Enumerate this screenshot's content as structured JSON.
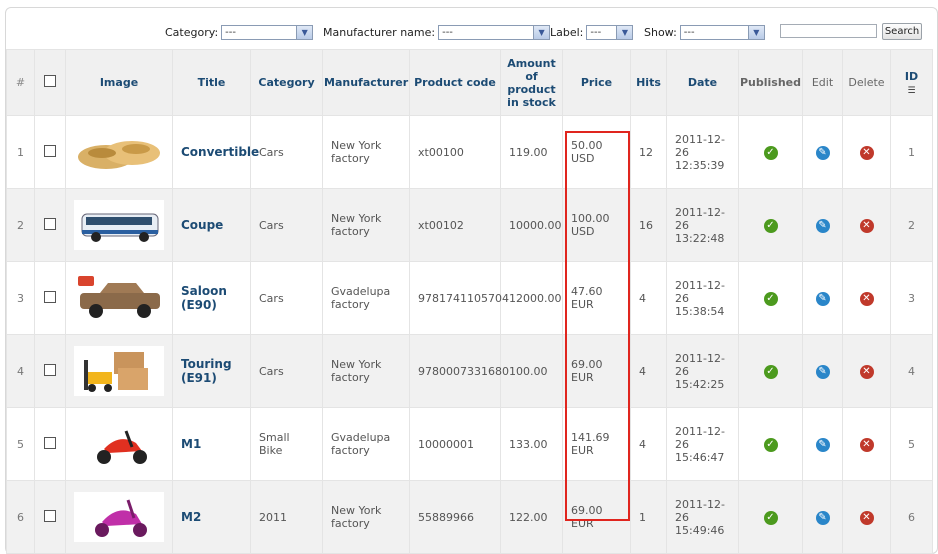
{
  "filters": {
    "category_label": "Category:",
    "category_value": "---",
    "manufacturer_label": "Manufacturer name:",
    "manufacturer_value": "---",
    "label_label": "Label:",
    "label_value": "---",
    "show_label": "Show:",
    "show_value": "---",
    "search_placeholder": "",
    "search_button": "Search"
  },
  "columns": {
    "num": "#",
    "image": "Image",
    "title": "Title",
    "category": "Category",
    "manufacturer": "Manufacturer",
    "product_code": "Product code",
    "stock": "Amount of product in stock",
    "price": "Price",
    "hits": "Hits",
    "date": "Date",
    "published": "Published",
    "edit": "Edit",
    "delete": "Delete",
    "id": "ID"
  },
  "rows": [
    {
      "num": "1",
      "title": "Convertible",
      "category": "Cars",
      "manufacturer": "New York factory",
      "code": "xt00100",
      "stock": "119.00",
      "price": "50.00 USD",
      "hits": "12",
      "date": "2011-12-26 12:35:39",
      "id": "1"
    },
    {
      "num": "2",
      "title": "Coupe",
      "category": "Cars",
      "manufacturer": "New York factory",
      "code": "xt00102",
      "stock": "10000.00",
      "price": "100.00 USD",
      "hits": "16",
      "date": "2011-12-26 13:22:48",
      "id": "2"
    },
    {
      "num": "3",
      "title": "Saloon (E90)",
      "category": "Cars",
      "manufacturer": "Gvadelupa factory",
      "code": "9781741105704",
      "stock": "12000.00",
      "price": "47.60 EUR",
      "hits": "4",
      "date": "2011-12-26 15:38:54",
      "id": "3"
    },
    {
      "num": "4",
      "title": "Touring (E91)",
      "category": "Cars",
      "manufacturer": "New York factory",
      "code": "9780007331680",
      "stock": "100.00",
      "price": "69.00 EUR",
      "hits": "4",
      "date": "2011-12-26 15:42:25",
      "id": "4"
    },
    {
      "num": "5",
      "title": "M1",
      "category": "Small Bike",
      "manufacturer": "Gvadelupa factory",
      "code": "10000001",
      "stock": "133.00",
      "price": "141.69 EUR",
      "hits": "4",
      "date": "2011-12-26 15:46:47",
      "id": "5"
    },
    {
      "num": "6",
      "title": "M2",
      "category": "2011",
      "manufacturer": "New York factory",
      "code": "55889966",
      "stock": "122.00",
      "price": "69.00 EUR",
      "hits": "1",
      "date": "2011-12-26 15:49:46",
      "id": "6"
    }
  ],
  "colors": {
    "header_text": "#1c4b74",
    "highlight": "#e0251e",
    "published": "#4c9a1e",
    "edit": "#2a86c9",
    "delete": "#c0392b"
  },
  "icons": {
    "published": "check-circle-icon",
    "edit": "pencil-icon",
    "delete": "x-circle-icon",
    "sort": "sort-icon",
    "dropdown": "chevron-down-icon"
  }
}
